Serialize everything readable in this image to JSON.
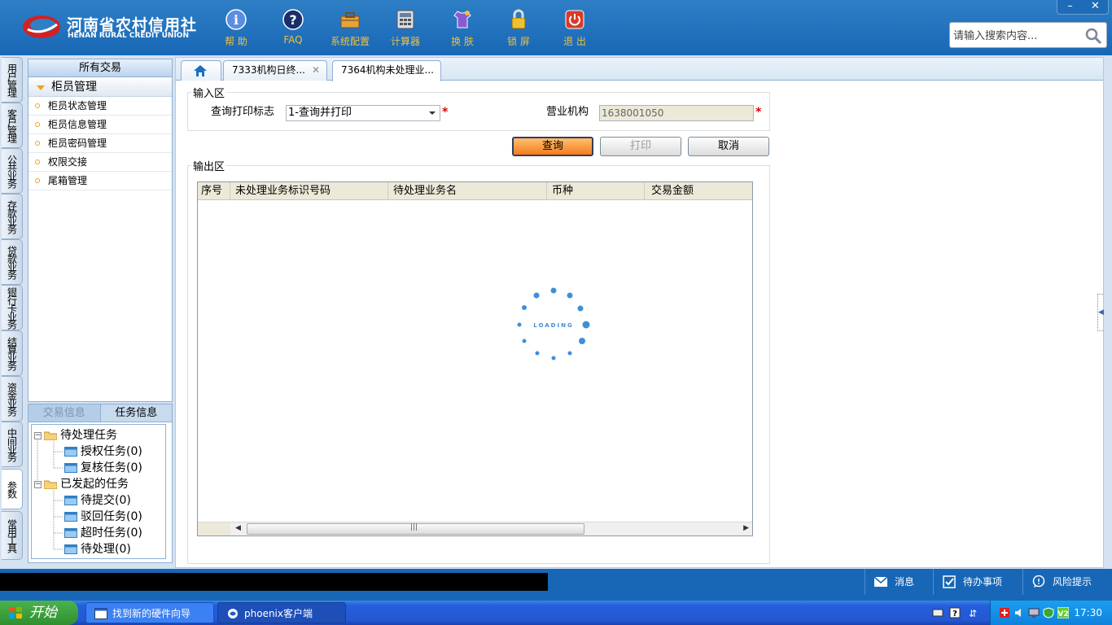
{
  "header": {
    "logo_cn": "河南省农村信用社",
    "logo_en": "HENAN RURAL CREDIT UNION",
    "toolbar": [
      {
        "label": "帮 助",
        "icon": "info-icon"
      },
      {
        "label": "FAQ",
        "icon": "question-icon"
      },
      {
        "label": "系统配置",
        "icon": "toolbox-icon"
      },
      {
        "label": "计算器",
        "icon": "calculator-icon"
      },
      {
        "label": "换 肤",
        "icon": "tshirt-icon"
      },
      {
        "label": "锁 屏",
        "icon": "lock-icon"
      },
      {
        "label": "退 出",
        "icon": "power-icon"
      }
    ],
    "search_placeholder": "请输入搜索内容...",
    "min_label": "–",
    "close_label": "✕"
  },
  "vnav": [
    "用户管理",
    "客户管理",
    "公共业务",
    "存款业务",
    "贷款业务",
    "银行卡业务",
    "结算业务",
    "资金业务",
    "中间业务",
    "参数",
    "常用工具"
  ],
  "menu": {
    "title": "所有交易",
    "group": "柜员管理",
    "items": [
      "柜员状态管理",
      "柜员信息管理",
      "柜员密码管理",
      "权限交接",
      "尾箱管理"
    ]
  },
  "taskpanel": {
    "tab_trade": "交易信息",
    "tab_task": "任务信息",
    "pending": "待处理任务",
    "auth": "授权任务(0)",
    "review": "复核任务(0)",
    "initiated": "已发起的任务",
    "submitted": "待提交(0)",
    "rejected": "驳回任务(0)",
    "timeout": "超时任务(0)",
    "processing": "待处理(0)"
  },
  "tabs": [
    "7333机构日终...",
    "7364机构未处理业..."
  ],
  "tab_close": "✕",
  "form": {
    "input_legend": "输入区",
    "print_flag_label": "查询打印标志",
    "print_flag_value": "1-查询并打印",
    "org_label": "营业机构",
    "org_value": "1638001050",
    "required": "*",
    "btn_query": "查询",
    "btn_print": "打印",
    "btn_cancel": "取消",
    "output_legend": "输出区"
  },
  "table": {
    "columns": [
      "序号",
      "未处理业务标识号码",
      "待处理业务名",
      "币种",
      "交易金额"
    ],
    "rows": []
  },
  "loading_text": "LOADING",
  "statusbar": {
    "messages": "消息",
    "todo": "待办事项",
    "risk": "风险提示"
  },
  "taskbar": {
    "start": "开始",
    "tasks": [
      "找到新的硬件向导",
      "phoenix客户端"
    ],
    "clock": "17:30"
  }
}
